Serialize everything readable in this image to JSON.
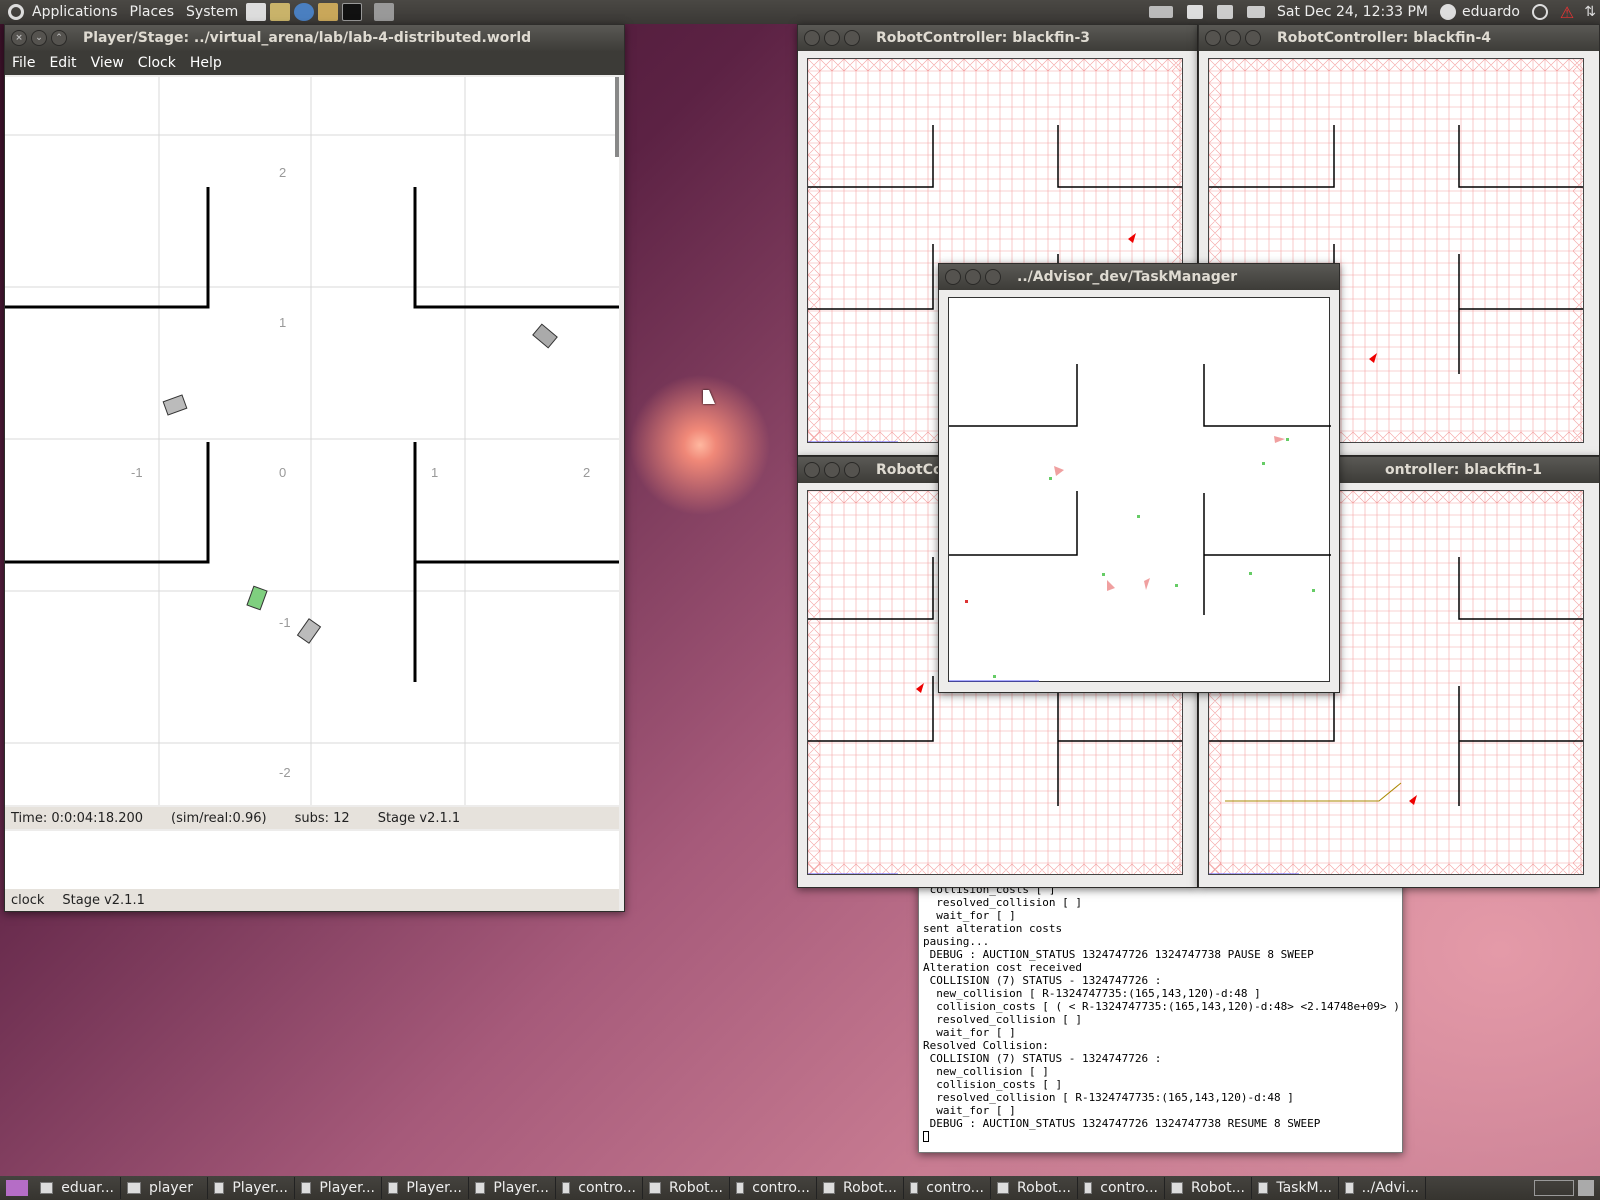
{
  "top_panel": {
    "menus": [
      "Applications",
      "Places",
      "System"
    ],
    "clock": "Sat Dec 24, 12:33 PM",
    "user": "eduardo"
  },
  "stage": {
    "title": "Player/Stage: ../virtual_arena/lab/lab-4-distributed.world",
    "menu": [
      "File",
      "Edit",
      "View",
      "Clock",
      "Help"
    ],
    "axis_labels": {
      "y2": "2",
      "y1": "1",
      "x_1": "-1",
      "x0": "0",
      "x1": "1",
      "x2": "2",
      "y_1": "-1",
      "y_2": "-2"
    },
    "status": {
      "time": "Time: 0:0:04:18.200",
      "ratio": "(sim/real:0.96)",
      "subs": "subs: 12",
      "version": "Stage v2.1.1"
    },
    "lower_status": {
      "clock": "clock",
      "version": "Stage v2.1.1"
    }
  },
  "robot_windows": {
    "b3": "RobotController: blackfin-3",
    "b4": "RobotController: blackfin-4",
    "b2": "RobotCo",
    "b1": "ontroller: blackfin-1"
  },
  "taskmanager": {
    "title": "../Advisor_dev/TaskManager"
  },
  "terminal": {
    "lines": [
      " collision_costs [ ]",
      "  resolved_collision [ ]",
      "  wait_for [ ]",
      "sent alteration costs",
      "pausing...",
      " DEBUG : AUCTION_STATUS 1324747726 1324747738 PAUSE 8 SWEEP",
      "Alteration cost received",
      " COLLISION (7) STATUS - 1324747726 :",
      "  new_collision [ R-1324747735:(165,143,120)-d:48 ]",
      "  collision_costs [ ( < R-1324747735:(165,143,120)-d:48> <2.14748e+09> ) ]",
      "  resolved_collision [ ]",
      "  wait_for [ ]",
      "Resolved Collision:",
      " COLLISION (7) STATUS - 1324747726 :",
      "  new_collision [ ]",
      "  collision_costs [ ]",
      "  resolved_collision [ R-1324747735:(165,143,120)-d:48 ]",
      "  wait_for [ ]",
      " DEBUG : AUCTION_STATUS 1324747726 1324747738 RESUME 8 SWEEP"
    ]
  },
  "taskbar": [
    "eduar...",
    "player",
    "Player...",
    "Player...",
    "Player...",
    "Player...",
    "contro...",
    "Robot...",
    "contro...",
    "Robot...",
    "contro...",
    "Robot...",
    "contro...",
    "Robot...",
    "TaskM...",
    "../Advi..."
  ]
}
